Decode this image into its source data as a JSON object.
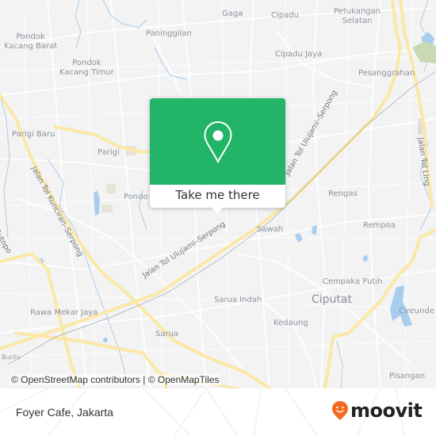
{
  "map": {
    "places": [
      {
        "id": "gaga",
        "label": "Gaga"
      },
      {
        "id": "cipadu",
        "label": "Cipadu"
      },
      {
        "id": "petukangan-selatan",
        "label": "Petukangan\nSelatan"
      },
      {
        "id": "pondok-kacang-barat",
        "label": "Pondok\nKacang Barat"
      },
      {
        "id": "paninggilan",
        "label": "Paninggilan"
      },
      {
        "id": "pondok-kacang-timur",
        "label": "Pondok\nKacang Timur"
      },
      {
        "id": "cipadu-jaya",
        "label": "Cipadu Jaya"
      },
      {
        "id": "pesanggrahan",
        "label": "Pesanggrahan"
      },
      {
        "id": "parigi-baru",
        "label": "Parigi Baru"
      },
      {
        "id": "parigi",
        "label": "Parigi"
      },
      {
        "id": "pondok",
        "label": "Pondo"
      },
      {
        "id": "rengas",
        "label": "Rengas"
      },
      {
        "id": "sawah",
        "label": "Sawah"
      },
      {
        "id": "rempoa",
        "label": "Rempoa"
      },
      {
        "id": "cempaka-putih",
        "label": "Cempaka Putih"
      },
      {
        "id": "rawa-mekar-jaya",
        "label": "Rawa Mekar Jaya"
      },
      {
        "id": "sarua-indah",
        "label": "Sarua Indah"
      },
      {
        "id": "ciputat",
        "label": "Ciputat"
      },
      {
        "id": "cireundeu",
        "label": "Cireunde"
      },
      {
        "id": "kedaung",
        "label": "Kedaung"
      },
      {
        "id": "sarua",
        "label": "Sarua"
      },
      {
        "id": "buntu",
        "label": "Buntu"
      },
      {
        "id": "pisangan",
        "label": "Pisangan"
      }
    ],
    "roads": {
      "ulujami_serpong_upper": "Jalan Tol Ulujami–Serpong",
      "ulujami_serpong_lower": "Jalan Tol Ulujami–Serpong",
      "kunciran_serpong": "Jalan Tol Kunciran–Serpong",
      "sutopo": "Jalan Sutopo",
      "lingkar": "Jalan Tol Ling"
    },
    "attribution": "© OpenStreetMap contributors | © OpenMapTiles"
  },
  "popup": {
    "icon": "map-pin-icon",
    "cta_label": "Take me there",
    "color": "#23b567"
  },
  "footer": {
    "title": "Foyer Cafe, Jakarta",
    "brand": "moovit",
    "brand_color": "#f26b21"
  }
}
